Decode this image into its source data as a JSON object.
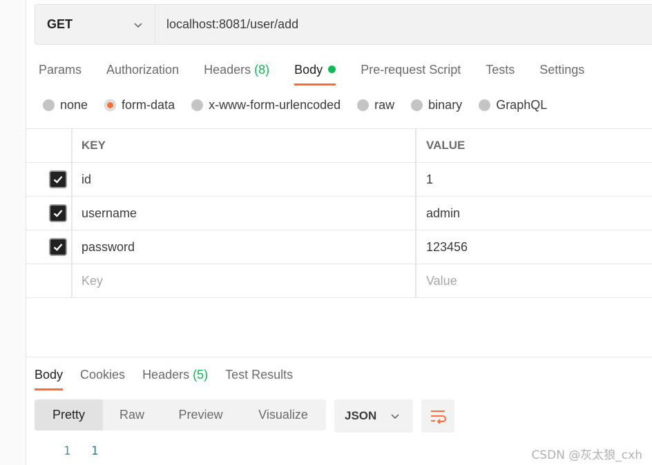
{
  "request": {
    "method": "GET",
    "url": "localhost:8081/user/add"
  },
  "request_tabs": [
    {
      "label": "Params"
    },
    {
      "label": "Authorization"
    },
    {
      "label": "Headers",
      "count": "(8)"
    },
    {
      "label": "Body",
      "active": true
    },
    {
      "label": "Pre-request Script"
    },
    {
      "label": "Tests"
    },
    {
      "label": "Settings"
    }
  ],
  "body_types": [
    {
      "label": "none"
    },
    {
      "label": "form-data",
      "selected": true
    },
    {
      "label": "x-www-form-urlencoded"
    },
    {
      "label": "raw"
    },
    {
      "label": "binary"
    },
    {
      "label": "GraphQL"
    }
  ],
  "table": {
    "key_header": "KEY",
    "value_header": "VALUE",
    "rows": [
      {
        "key": "id",
        "value": "1",
        "checked": true
      },
      {
        "key": "username",
        "value": "admin",
        "checked": true
      },
      {
        "key": "password",
        "value": "123456",
        "checked": true
      }
    ],
    "key_placeholder": "Key",
    "value_placeholder": "Value"
  },
  "response_tabs": [
    {
      "label": "Body",
      "active": true
    },
    {
      "label": "Cookies"
    },
    {
      "label": "Headers",
      "count": "(5)"
    },
    {
      "label": "Test Results"
    }
  ],
  "view_modes": [
    "Pretty",
    "Raw",
    "Preview",
    "Visualize"
  ],
  "format": "JSON",
  "response_body": {
    "line_number": "1",
    "content": "1"
  },
  "watermark": "CSDN @灰太狼_cxh",
  "colors": {
    "accent": "#ff6c37",
    "success": "#0cbb52"
  },
  "icons": {
    "method_dropdown": "chevron-down-icon",
    "format_dropdown": "chevron-down-icon",
    "wrap": "wrap-lines-icon",
    "checkbox": "check-icon"
  }
}
